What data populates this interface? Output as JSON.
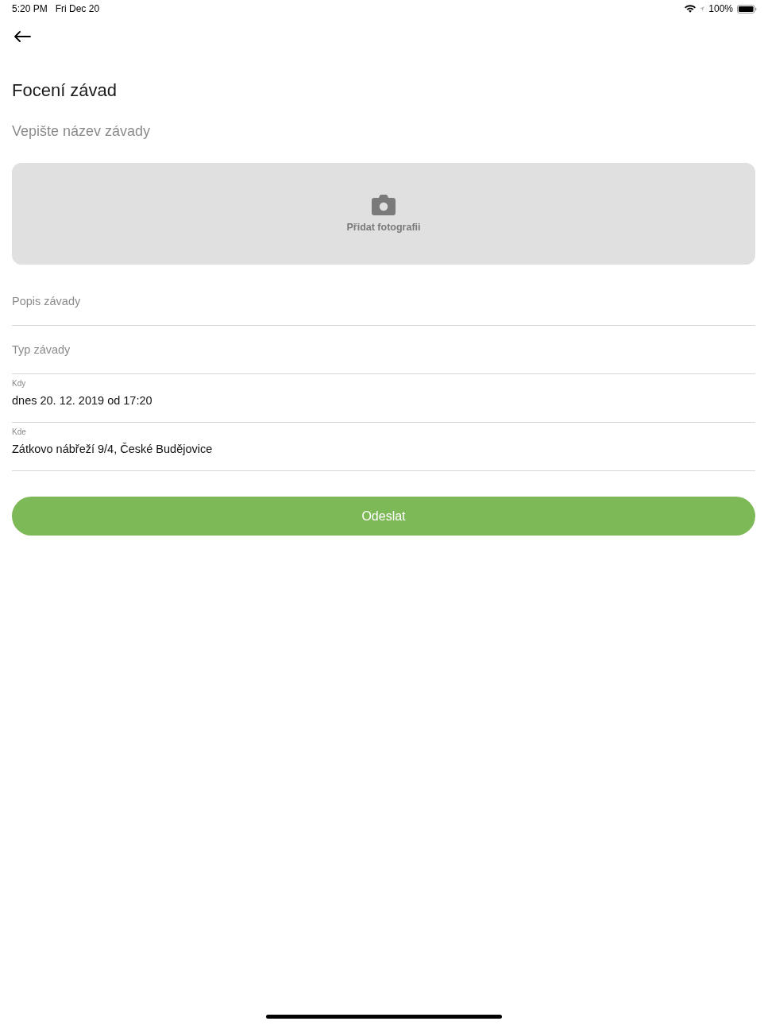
{
  "status_bar": {
    "time": "5:20 PM",
    "date": "Fri Dec 20",
    "battery_text": "100%"
  },
  "header": {
    "title": "Focení závad"
  },
  "name_field": {
    "placeholder": "Vepište název závady"
  },
  "photo": {
    "label": "Přidat fotografii"
  },
  "fields": [
    {
      "kind": "input",
      "placeholder": "Popis závady"
    },
    {
      "kind": "input",
      "placeholder": "Typ závady"
    },
    {
      "kind": "value",
      "label": "Kdy",
      "value": "dnes 20. 12. 2019 od 17:20"
    },
    {
      "kind": "value",
      "label": "Kde",
      "value": "Zátkovo nábřeží 9/4, České Budějovice"
    }
  ],
  "submit_button": {
    "label": "Odeslat"
  }
}
